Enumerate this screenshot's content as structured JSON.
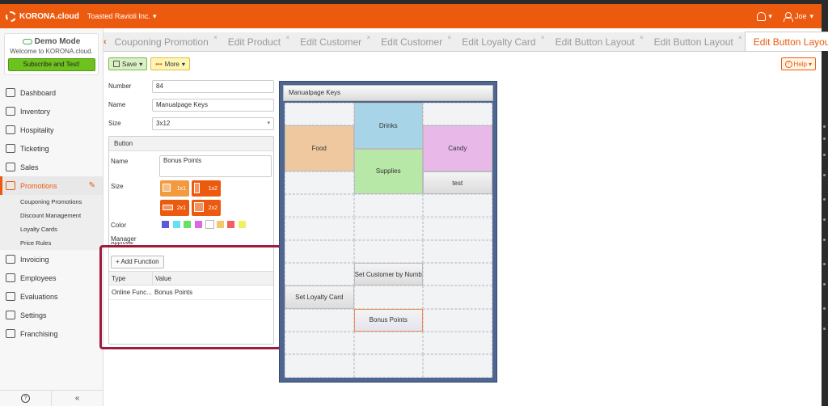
{
  "topbar": {
    "brand": "KORONA.cloud",
    "company": "Toasted Ravioli Inc.",
    "company_caret": "▾",
    "user": "Joe",
    "user_caret": "▾",
    "bell_caret": "▾"
  },
  "sidebar": {
    "demo_title": "Demo Mode",
    "demo_subtitle": "Welcome to KORONA.cloud.",
    "demo_button": "Subscribe and Test!",
    "items": [
      {
        "label": "Dashboard"
      },
      {
        "label": "Inventory"
      },
      {
        "label": "Hospitality"
      },
      {
        "label": "Ticketing"
      },
      {
        "label": "Sales"
      },
      {
        "label": "Promotions"
      },
      {
        "label": "Invoicing"
      },
      {
        "label": "Employees"
      },
      {
        "label": "Evaluations"
      },
      {
        "label": "Settings"
      },
      {
        "label": "Franchising"
      }
    ],
    "sub_items": [
      {
        "label": "Couponing Promotions"
      },
      {
        "label": "Discount Management"
      },
      {
        "label": "Loyalty Cards"
      },
      {
        "label": "Price Rules"
      }
    ],
    "footer_help": "?",
    "footer_collapse": "«"
  },
  "tabs": [
    {
      "label": "Couponing Promotion"
    },
    {
      "label": "Edit Product"
    },
    {
      "label": "Edit Customer"
    },
    {
      "label": "Edit Customer"
    },
    {
      "label": "Edit Loyalty Card"
    },
    {
      "label": "Edit Button Layout"
    },
    {
      "label": "Edit Button Layout"
    },
    {
      "label": "Edit Button Layout"
    }
  ],
  "tab_close": "×",
  "tab_prev": "‹",
  "tab_next": "›",
  "toolbar": {
    "save_label": "Save",
    "more_label": "More",
    "help_label": "Help",
    "caret": "▾"
  },
  "form": {
    "number_label": "Number",
    "number_value": "84",
    "name_label": "Name",
    "name_value": "Manualpage Keys",
    "size_label": "Size",
    "size_value": "3x12"
  },
  "button_panel": {
    "header": "Button",
    "name_label": "Name",
    "name_value": "Bonus Points",
    "size_label": "Size",
    "size_options": [
      {
        "label": "1x1"
      },
      {
        "label": "1x2"
      },
      {
        "label": "2x1"
      },
      {
        "label": "2x2"
      }
    ],
    "color_label": "Color",
    "colors": [
      "#5b5bd6",
      "#66e0f0",
      "#66e066",
      "#e066e0",
      "#ffffff",
      "#f5c870",
      "#f06060",
      "#f0f060"
    ],
    "manager_label": "Manager",
    "manager_label2": "Approval",
    "add_function": "+ Add Function",
    "table_headers": [
      "Type",
      "Value"
    ],
    "rows": [
      {
        "type": "Online Func...",
        "value": "Bonus Points"
      }
    ]
  },
  "layout": {
    "title": "Manualpage Keys",
    "keys": [
      {
        "label": "Food",
        "color": "#f0c8a0"
      },
      {
        "label": "Drinks",
        "color": "#a8d4e8"
      },
      {
        "label": "Candy",
        "color": "#e8b8e8"
      },
      {
        "label": "Supplies",
        "color": "#b8e8a8"
      },
      {
        "label": "test",
        "color": "#dcdcdc"
      },
      {
        "label": "Set Customer by Numb",
        "color": "#dcdcdc"
      },
      {
        "label": "Set Loyalty Card",
        "color": "#dcdcdc"
      },
      {
        "label": "Bonus Points",
        "color": "#e4e4ee"
      }
    ]
  }
}
